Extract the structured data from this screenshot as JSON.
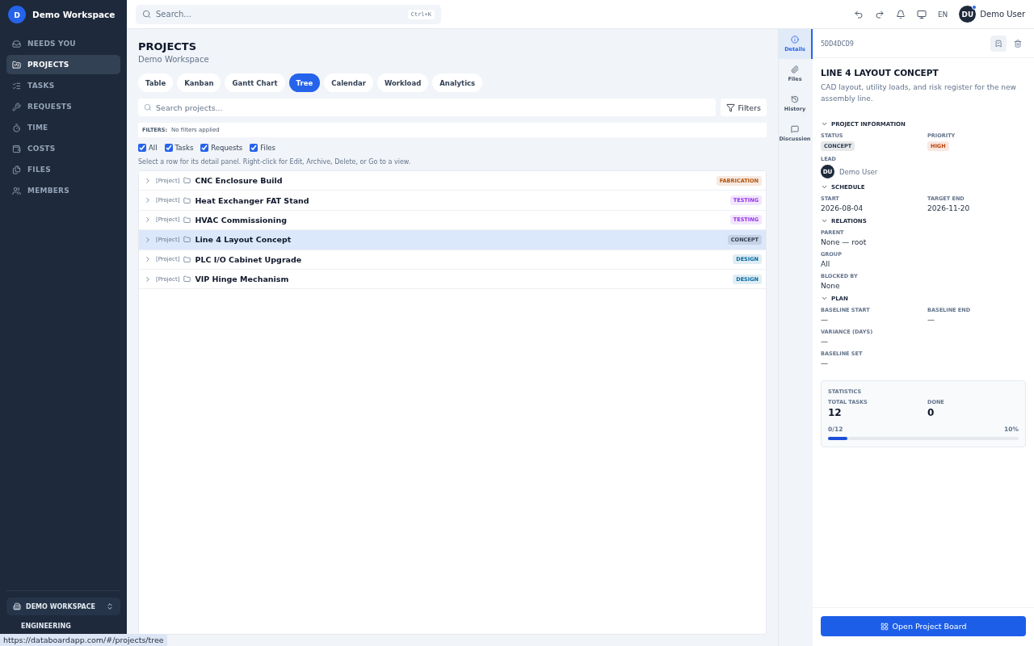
{
  "sidebar": {
    "workspace": {
      "initial": "D",
      "name": "Demo Workspace"
    },
    "items": [
      {
        "label": "NEEDS YOU",
        "selected": false
      },
      {
        "label": "PROJECTS",
        "selected": true
      },
      {
        "label": "TASKS",
        "selected": false
      },
      {
        "label": "REQUESTS",
        "selected": false
      },
      {
        "label": "TIME",
        "selected": false
      },
      {
        "label": "COSTS",
        "selected": false
      },
      {
        "label": "FILES",
        "selected": false
      },
      {
        "label": "MEMBERS",
        "selected": false
      }
    ],
    "switcher": "DEMO WORKSPACE",
    "team": "ENGINEERING"
  },
  "topbar": {
    "search_placeholder": "Search...",
    "shortcut": "Ctrl+K",
    "language": "EN",
    "user": {
      "initials": "DU",
      "name": "Demo User",
      "notification": true
    }
  },
  "page": {
    "title": "PROJECTS",
    "subtitle": "Demo Workspace",
    "view_tabs": [
      {
        "label": "Table",
        "selected": false
      },
      {
        "label": "Kanban",
        "selected": false
      },
      {
        "label": "Gantt Chart",
        "selected": false
      },
      {
        "label": "Tree",
        "selected": true
      },
      {
        "label": "Calendar",
        "selected": false
      },
      {
        "label": "Workload",
        "selected": false
      },
      {
        "label": "Analytics",
        "selected": false
      }
    ],
    "search_placeholder": "Search projects...",
    "filters_button": "Filters",
    "filter_summary": {
      "label": "FILTERS:",
      "value": "No filters applied"
    },
    "type_checks": [
      {
        "label": "All",
        "checked": true
      },
      {
        "label": "Tasks",
        "checked": true
      },
      {
        "label": "Requests",
        "checked": true
      },
      {
        "label": "Files",
        "checked": true
      }
    ],
    "hint": "Select a row for its detail panel. Right-click for Edit, Archive, Delete, or Go to a view.",
    "rows": [
      {
        "prefix": "[Project]",
        "name": "CNC Enclosure Build",
        "status": "FABRICATION",
        "color": "#b45309",
        "selected": false
      },
      {
        "prefix": "[Project]",
        "name": "Heat Exchanger FAT Stand",
        "status": "TESTING",
        "color": "#9333ea",
        "selected": false
      },
      {
        "prefix": "[Project]",
        "name": "HVAC Commissioning",
        "status": "TESTING",
        "color": "#9333ea",
        "selected": false
      },
      {
        "prefix": "[Project]",
        "name": "Line 4 Layout Concept",
        "status": "CONCEPT",
        "color": "#334155",
        "selected": true
      },
      {
        "prefix": "[Project]",
        "name": "PLC I/O Cabinet Upgrade",
        "status": "DESIGN",
        "color": "#0369a1",
        "selected": false
      },
      {
        "prefix": "[Project]",
        "name": "VIP Hinge Mechanism",
        "status": "DESIGN",
        "color": "#0369a1",
        "selected": false
      }
    ]
  },
  "rail": [
    {
      "label": "Details",
      "selected": true
    },
    {
      "label": "Files",
      "selected": false
    },
    {
      "label": "History",
      "selected": false
    },
    {
      "label": "Discussion",
      "selected": false
    }
  ],
  "detail": {
    "id": "5DD4DCD9",
    "title": "LINE 4 LAYOUT CONCEPT",
    "description": "CAD layout, utility loads, and risk register for the new assembly line.",
    "sections": [
      {
        "title": "PROJECT INFORMATION",
        "expanded": true,
        "fields": [
          {
            "label": "STATUS",
            "value": "CONCEPT",
            "kind": "badge",
            "color": "#334155"
          },
          {
            "label": "PRIORITY",
            "value": "HIGH",
            "kind": "badge",
            "color": "#c2410c"
          },
          {
            "label": "LEAD",
            "value": "Demo User",
            "initials": "DU",
            "kind": "user"
          }
        ]
      },
      {
        "title": "SCHEDULE",
        "expanded": true,
        "fields": [
          {
            "label": "START",
            "value": "2026-08-04",
            "kind": "text"
          },
          {
            "label": "TARGET END",
            "value": "2026-11-20",
            "kind": "text"
          }
        ]
      },
      {
        "title": "RELATIONS",
        "expanded": true,
        "fields": [
          {
            "label": "PARENT",
            "value": "None — root",
            "kind": "wide"
          },
          {
            "label": "GROUP",
            "value": "All",
            "kind": "wide"
          },
          {
            "label": "BLOCKED BY",
            "value": "None",
            "kind": "wide"
          }
        ]
      },
      {
        "title": "PLAN",
        "expanded": true,
        "fields": [
          {
            "label": "BASELINE START",
            "value": "—",
            "kind": "text"
          },
          {
            "label": "BASELINE END",
            "value": "—",
            "kind": "text"
          },
          {
            "label": "VARIANCE (DAYS)",
            "value": "—",
            "kind": "wide"
          },
          {
            "label": "BASELINE SET",
            "value": "—",
            "kind": "wide"
          }
        ]
      }
    ],
    "statistics": {
      "title": "STATISTICS",
      "total_label": "TOTAL TASKS",
      "total": "12",
      "done_label": "DONE",
      "done": "0",
      "progress": "0/12",
      "percent": "10%",
      "level": 0.1
    },
    "button": "Open Project Board"
  },
  "browser_status": "https://databoardapp.com/#/projects/tree"
}
